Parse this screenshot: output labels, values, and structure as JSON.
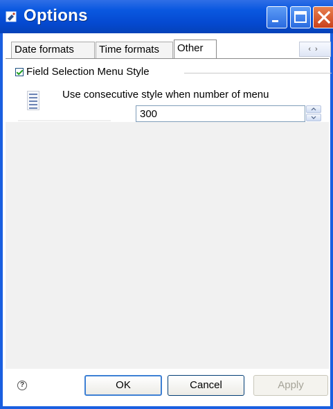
{
  "window": {
    "title": "Options",
    "buttons": {
      "minimize": "minimize",
      "maximize": "maximize",
      "close": "close"
    }
  },
  "tabs": [
    {
      "label": "Date formats",
      "selected": false
    },
    {
      "label": "Time formats",
      "selected": false
    },
    {
      "label": "Other",
      "selected": true
    }
  ],
  "tab_scroll": {
    "left": "‹",
    "right": "›"
  },
  "group": {
    "label": "Field Selection Menu Style",
    "checked": true
  },
  "setting": {
    "label": "Use consecutive style when number of menu",
    "value": "300",
    "icon": "document-list-icon"
  },
  "footer": {
    "help_icon": "?",
    "ok_label": "OK",
    "cancel_label": "Cancel",
    "apply_label": "Apply",
    "apply_enabled": false
  },
  "colors": {
    "titlebar": "#0a58e0",
    "close_button": "#c9401c",
    "input_border": "#7f9db9"
  }
}
